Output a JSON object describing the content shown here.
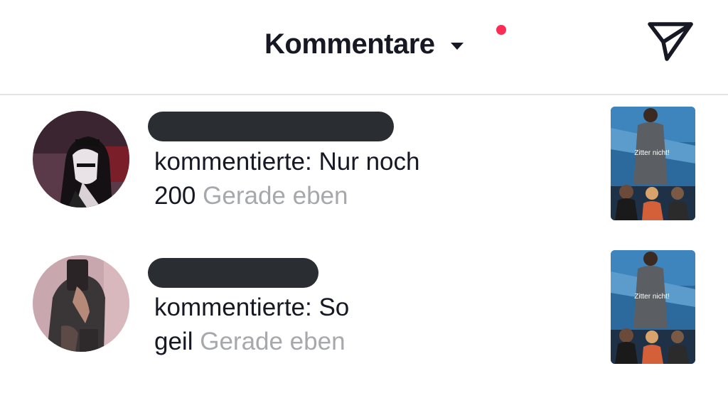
{
  "header": {
    "title": "Kommentare",
    "has_notification_dot": true,
    "filter_icon": "send-paper-plane-icon"
  },
  "notifications": [
    {
      "username_redacted": true,
      "comment_line1": "kommentierte: Nur noch",
      "comment_line2": "200",
      "time": "Gerade eben",
      "thumbnail_caption": "Zitter nicht!"
    },
    {
      "username_redacted": true,
      "comment_line1": "kommentierte: So",
      "comment_line2": "geil",
      "time": "Gerade eben",
      "thumbnail_caption": "Zitter nicht!"
    }
  ],
  "colors": {
    "accent_dot": "#fe2c55",
    "text": "#161823",
    "muted": "#a7a8ac",
    "redaction": "#2a2e33"
  }
}
